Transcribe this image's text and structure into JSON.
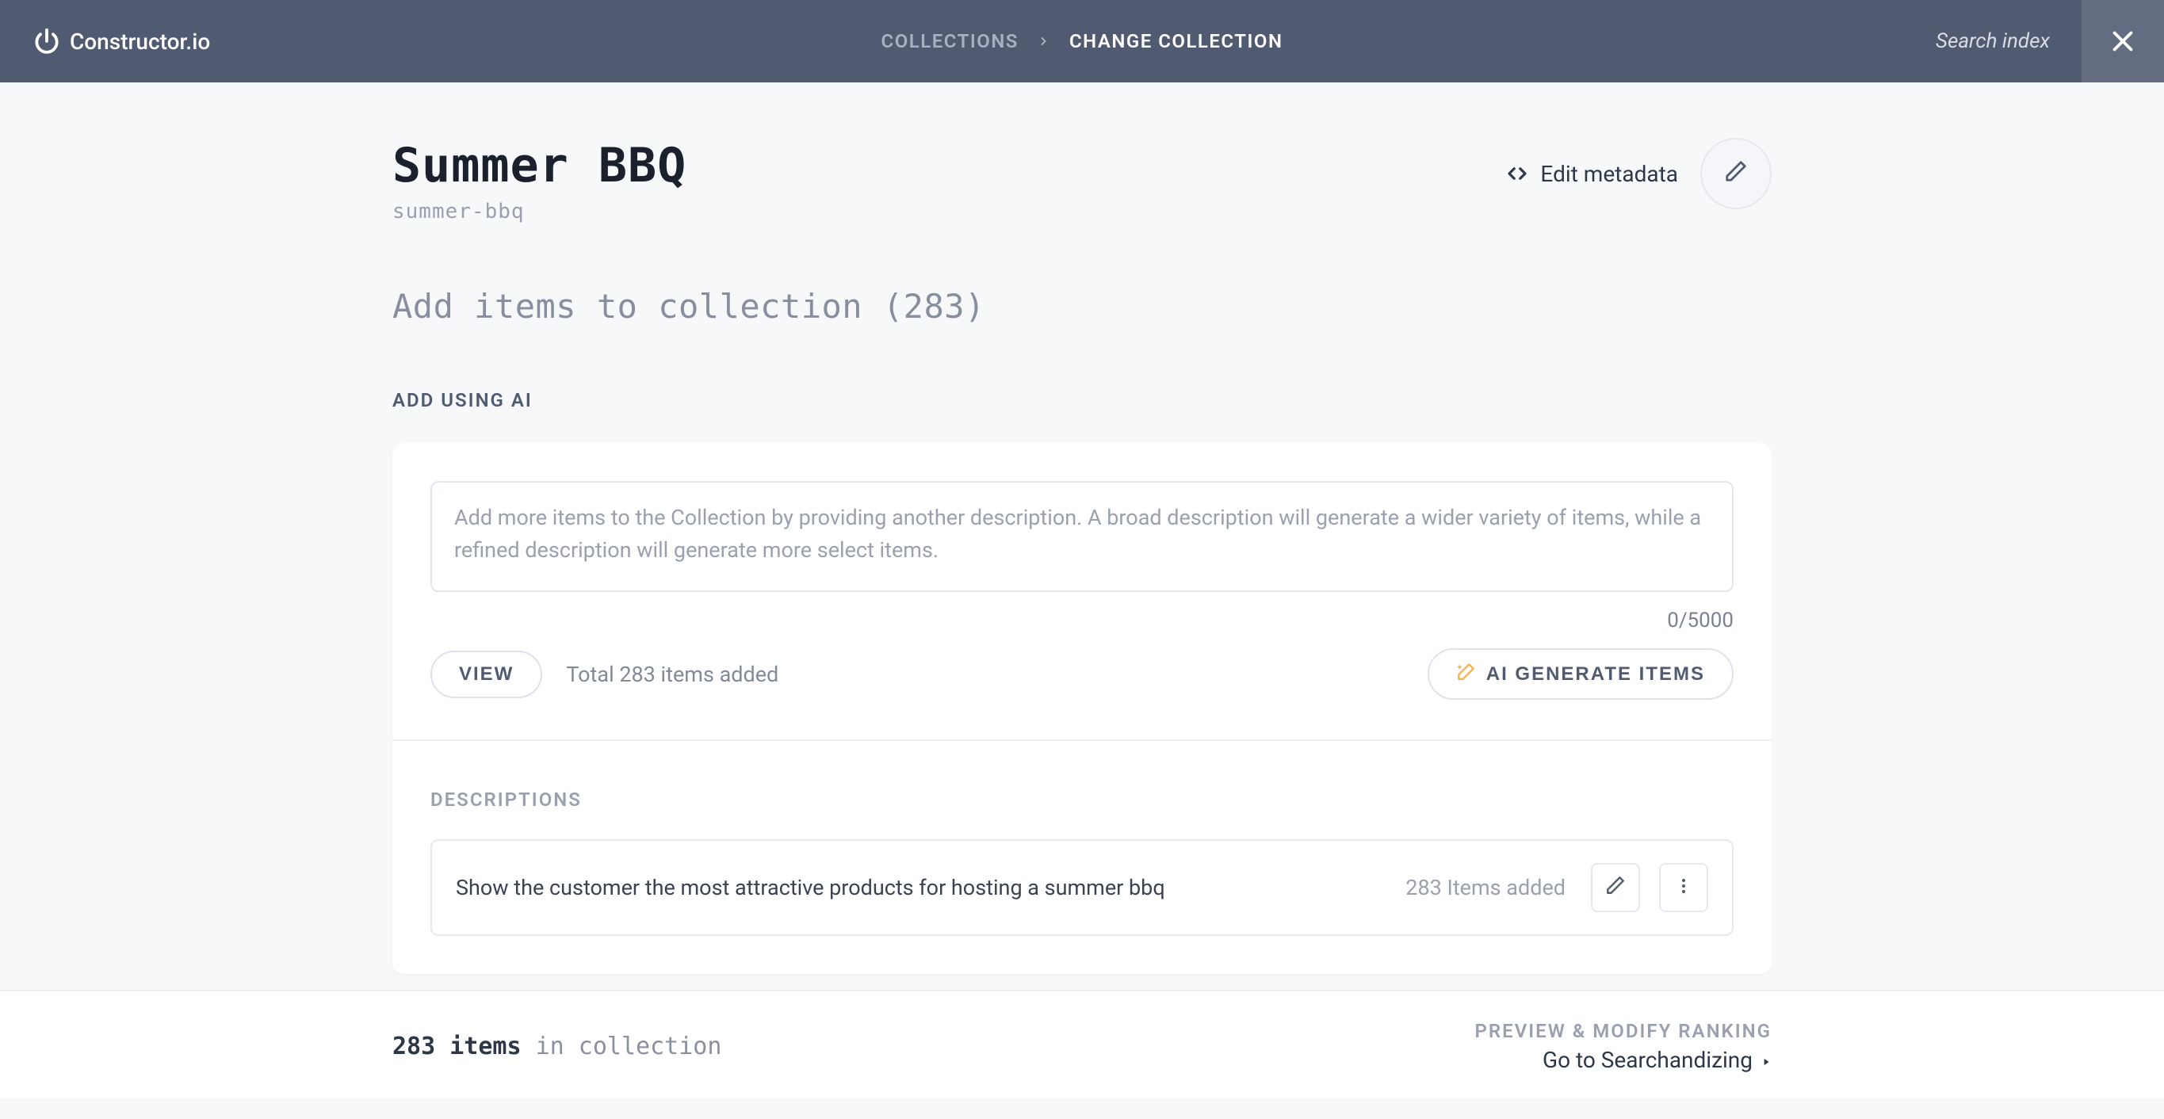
{
  "header": {
    "brand": "Constructor.io",
    "breadcrumb_parent": "COLLECTIONS",
    "breadcrumb_current": "CHANGE COLLECTION",
    "search_label": "Search index"
  },
  "title": {
    "name": "Summer BBQ",
    "slug": "summer-bbq",
    "edit_metadata_label": "Edit metadata"
  },
  "section": {
    "heading": "Add items to collection (283)",
    "add_ai_label": "ADD USING AI"
  },
  "ai": {
    "placeholder": "Add more items to the Collection by providing another description. A broad description will generate a wider variety of items, while a refined description will generate more select items.",
    "char_count": "0/5000",
    "view_label": "VIEW",
    "total_text": "Total 283 items added",
    "generate_label": "AI GENERATE ITEMS"
  },
  "descriptions": {
    "label": "DESCRIPTIONS",
    "items": [
      {
        "text": "Show the customer the most attractive products for hosting a summer bbq",
        "count": "283 Items added"
      }
    ]
  },
  "footer": {
    "count_strong": "283 items",
    "count_rest": " in collection",
    "preview_label": "PREVIEW & MODIFY RANKING",
    "searchandizing_label": "Go to Searchandizing"
  }
}
